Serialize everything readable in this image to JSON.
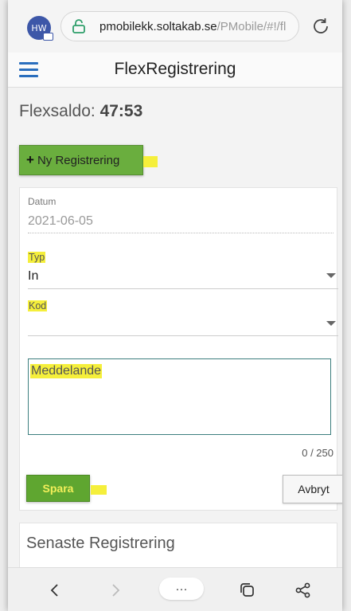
{
  "browser": {
    "avatar_text": "HW",
    "url_host": "pmobilekk.soltakab.se",
    "url_path": "/PMobile/#!/fl"
  },
  "header": {
    "title": "FlexRegistrering"
  },
  "saldo": {
    "label": "Flexsaldo:",
    "value": "47:53"
  },
  "actions": {
    "new_button_label": "Ny Registrering"
  },
  "form": {
    "datum_label": "Datum",
    "datum_value": "2021-06-05",
    "typ_label": "Typ",
    "typ_value": "In",
    "kod_label": "Kod",
    "kod_value": "",
    "message_placeholder": "Meddelande",
    "message_counter": "0 / 250",
    "save_label": "Spara",
    "cancel_label": "Avbryt"
  },
  "recent": {
    "title": "Senaste Registrering"
  },
  "bottom_nav": {
    "more_label": "···"
  },
  "colors": {
    "accent_blue": "#2a6ebd",
    "button_green": "#6aae3e",
    "highlight_yellow": "#f5ef3b"
  },
  "icons": [
    "lock-icon",
    "reload-icon",
    "menu-icon",
    "plus-icon",
    "chevron-down-icon",
    "back-icon",
    "forward-icon",
    "tabs-icon",
    "share-icon"
  ]
}
